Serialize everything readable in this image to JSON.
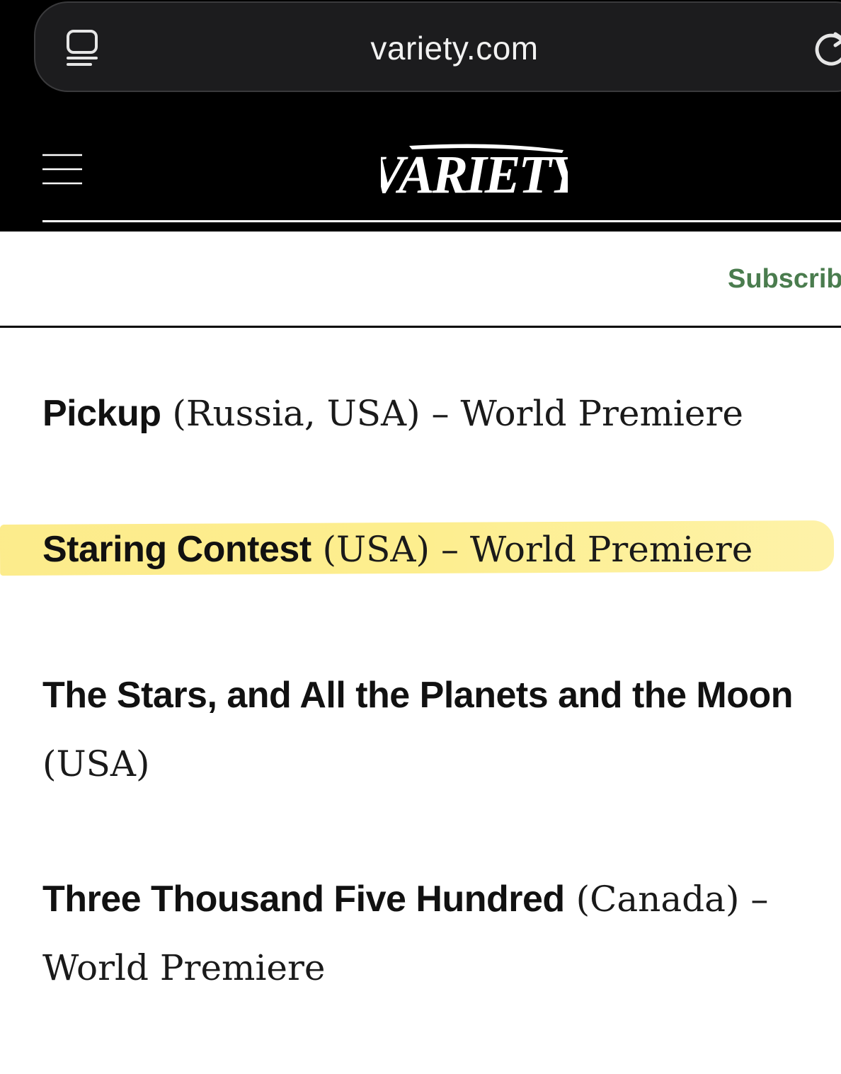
{
  "browser": {
    "url": "variety.com",
    "tabs_icon": "tabs-icon",
    "reload_icon": "reload-icon"
  },
  "header": {
    "logo_text": "VARIETY",
    "menu_icon": "hamburger-menu-icon",
    "background": "#000000"
  },
  "subscribe": {
    "label": "Subscrib",
    "color": "#4a7c4e"
  },
  "entries": [
    {
      "title": "Pickup",
      "meta": " (Russia, USA) – World Premiere",
      "highlighted": false
    },
    {
      "title": "Staring Contest",
      "meta": " (USA) – World Premiere",
      "highlighted": true
    },
    {
      "title": "The Stars, and All the Planets and the Moon",
      "meta": " (USA)",
      "highlighted": false
    },
    {
      "title": "Three Thousand Five Hundred",
      "meta": " (Canada) – World Premiere",
      "highlighted": false
    },
    {
      "title": "",
      "meta": "",
      "highlighted": false
    }
  ],
  "highlight_color": "#fce878"
}
